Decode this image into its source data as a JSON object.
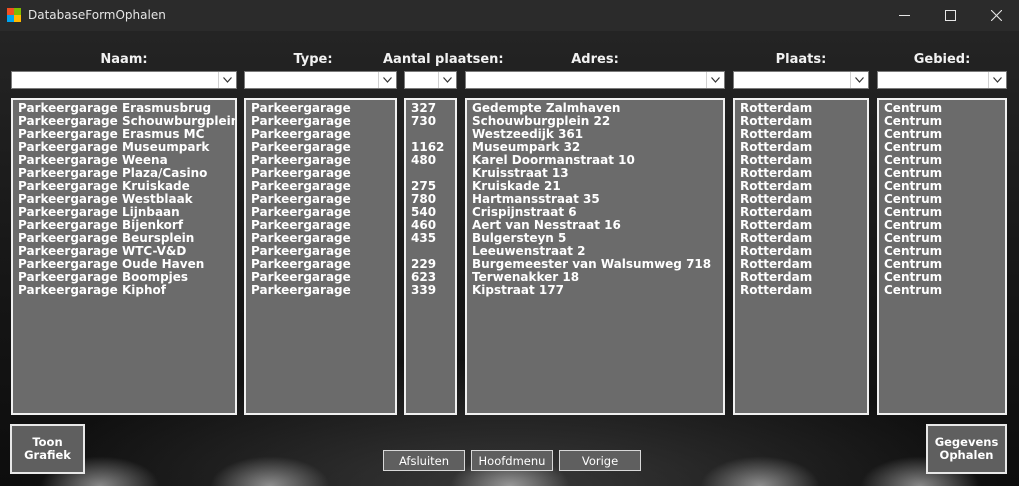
{
  "window": {
    "title": "DatabaseFormOphalen"
  },
  "headers": {
    "naam": "Naam:",
    "type": "Type:",
    "aantal": "Aantal plaatsen:",
    "adres": "Adres:",
    "plaats": "Plaats:",
    "gebied": "Gebied:"
  },
  "filters": {
    "naam": "",
    "type": "",
    "aantal": "",
    "adres": "",
    "plaats": "",
    "gebied": ""
  },
  "lists": {
    "naam": [
      "Parkeergarage Erasmusbrug",
      "Parkeergarage Schouwburgplein",
      "Parkeergarage Erasmus MC",
      "Parkeergarage Museumpark",
      "Parkeergarage Weena",
      "Parkeergarage Plaza/Casino",
      "Parkeergarage Kruiskade",
      "Parkeergarage Westblaak",
      "Parkeergarage Lijnbaan",
      "Parkeergarage Bijenkorf",
      "Parkeergarage Beursplein",
      "Parkeergarage WTC-V&D",
      "Parkeergarage Oude Haven",
      "Parkeergarage Boompjes",
      "Parkeergarage Kiphof"
    ],
    "type": [
      "Parkeergarage",
      "Parkeergarage",
      "Parkeergarage",
      "Parkeergarage",
      "Parkeergarage",
      "Parkeergarage",
      "Parkeergarage",
      "Parkeergarage",
      "Parkeergarage",
      "Parkeergarage",
      "Parkeergarage",
      "Parkeergarage",
      "Parkeergarage",
      "Parkeergarage",
      "Parkeergarage"
    ],
    "aantal": [
      "327",
      "730",
      "",
      "1162",
      "480",
      "",
      "275",
      "780",
      "540",
      "460",
      "435",
      "",
      "229",
      "623",
      "339"
    ],
    "adres": [
      "Gedempte Zalmhaven",
      "Schouwburgplein 22",
      "Westzeedijk 361",
      "Museumpark 32",
      "Karel Doormanstraat 10",
      "Kruisstraat 13",
      "Kruiskade 21",
      "Hartmansstraat 35",
      "Crispijnstraat 6",
      "Aert van Nesstraat 16",
      "Bulgersteyn 5",
      "Leeuwenstraat 2",
      "Burgemeester van Walsumweg 718",
      "Terwenakker 18",
      "Kipstraat 177"
    ],
    "plaats": [
      "Rotterdam",
      "Rotterdam",
      "Rotterdam",
      "Rotterdam",
      "Rotterdam",
      "Rotterdam",
      "Rotterdam",
      "Rotterdam",
      "Rotterdam",
      "Rotterdam",
      "Rotterdam",
      "Rotterdam",
      "Rotterdam",
      "Rotterdam",
      "Rotterdam"
    ],
    "gebied": [
      "Centrum",
      "Centrum",
      "Centrum",
      "Centrum",
      "Centrum",
      "Centrum",
      "Centrum",
      "Centrum",
      "Centrum",
      "Centrum",
      "Centrum",
      "Centrum",
      "Centrum",
      "Centrum",
      "Centrum"
    ]
  },
  "buttons": {
    "toon_grafiek": "Toon Grafiek",
    "gegevens_ophalen": "Gegevens Ophalen",
    "afsluiten": "Afsluiten",
    "hoofdmenu": "Hoofdmenu",
    "vorige": "Vorige"
  },
  "icons": {
    "app": "app-icon",
    "minimize": "minimize-icon",
    "maximize": "maximize-icon",
    "close": "close-icon",
    "dropdown": "chevron-down-icon"
  }
}
